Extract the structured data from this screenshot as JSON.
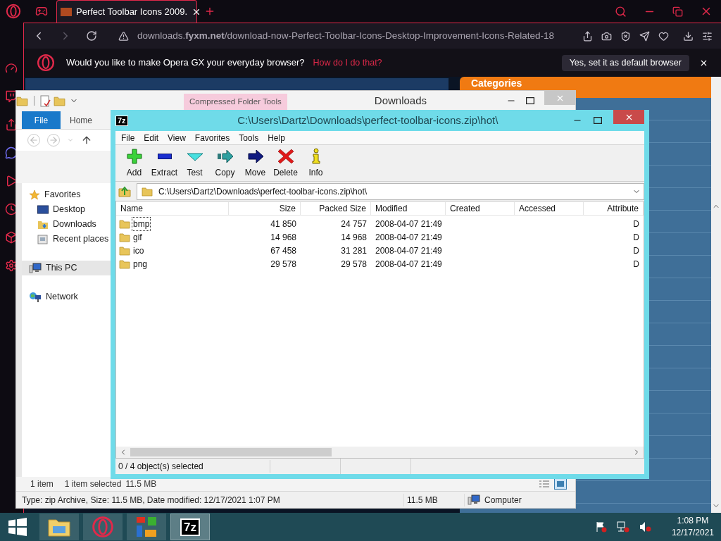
{
  "browser": {
    "tabs": [
      {
        "title": "Perfect Toolbar Icons 2009.",
        "selected": true
      }
    ],
    "address": "downloads.**fyxm.net**/download-now-Perfect-Toolbar-Icons-Desktop-Improvement-Icons-Related-18",
    "prompt": {
      "message": "Would you like to make Opera GX your everyday browser?",
      "link": "How do I do that?",
      "button": "Yes, set it as default browser"
    },
    "page": {
      "heading": "Categories"
    }
  },
  "explorer": {
    "contextual_tab": "Compressed Folder Tools",
    "title": "Downloads",
    "ribbon_tabs": [
      {
        "label": "File",
        "kind": "backstage"
      },
      {
        "label": "Home",
        "kind": "tab"
      }
    ],
    "nav": [
      {
        "label": "Favorites",
        "kind": "favorites",
        "selected": false,
        "children": [
          {
            "label": "Desktop",
            "kind": "desktop",
            "selected": false
          },
          {
            "label": "Downloads",
            "kind": "downloads",
            "selected": false
          },
          {
            "label": "Recent places",
            "kind": "recent",
            "selected": false
          }
        ]
      },
      {
        "label": "This PC",
        "kind": "pc",
        "selected": true
      },
      {
        "label": "Network",
        "kind": "network",
        "selected": false
      }
    ],
    "item_count": "1 item",
    "selection": "1 item selected",
    "selection_size": "11.5 MB",
    "details": {
      "text": "Type: zip Archive, Size: 11.5 MB, Date modified: 12/17/2021 1:07 PM",
      "size": "11.5 MB",
      "location": "Computer"
    }
  },
  "sevenzip": {
    "logo": "7z",
    "title": "C:\\Users\\Dartz\\Downloads\\perfect-toolbar-icons.zip\\hot\\",
    "menu": [
      "File",
      "Edit",
      "View",
      "Favorites",
      "Tools",
      "Help"
    ],
    "toolbar": [
      {
        "label": "Add",
        "kind": "add"
      },
      {
        "label": "Extract",
        "kind": "extract"
      },
      {
        "label": "Test",
        "kind": "test"
      },
      {
        "label": "Copy",
        "kind": "copy"
      },
      {
        "label": "Move",
        "kind": "move"
      },
      {
        "label": "Delete",
        "kind": "delete"
      },
      {
        "label": "Info",
        "kind": "info"
      }
    ],
    "path": "C:\\Users\\Dartz\\Downloads\\perfect-toolbar-icons.zip\\hot\\",
    "columns": [
      "Name",
      "Size",
      "Packed Size",
      "Modified",
      "Created",
      "Accessed",
      "Attribute"
    ],
    "rows": [
      {
        "name": "bmp",
        "size": "41 850",
        "packed_size": "24 757",
        "modified": "2008-04-07 21:49",
        "attributes": "D",
        "focused": true
      },
      {
        "name": "gif",
        "size": "14 968",
        "packed_size": "14 968",
        "modified": "2008-04-07 21:49",
        "attributes": "D",
        "focused": false
      },
      {
        "name": "ico",
        "size": "67 458",
        "packed_size": "31 281",
        "modified": "2008-04-07 21:49",
        "attributes": "D",
        "focused": false
      },
      {
        "name": "png",
        "size": "29 578",
        "packed_size": "29 578",
        "modified": "2008-04-07 21:49",
        "attributes": "D",
        "focused": false
      }
    ],
    "status": "0 / 4 object(s) selected"
  },
  "taskbar": {
    "apps": [
      {
        "kind": "explorer",
        "selected": false
      },
      {
        "kind": "opera",
        "selected": false
      },
      {
        "kind": "tiles",
        "selected": false
      },
      {
        "kind": "sevenzip",
        "label": "7z",
        "selected": true
      }
    ],
    "time": "1:08 PM",
    "date": "12/17/2021"
  }
}
